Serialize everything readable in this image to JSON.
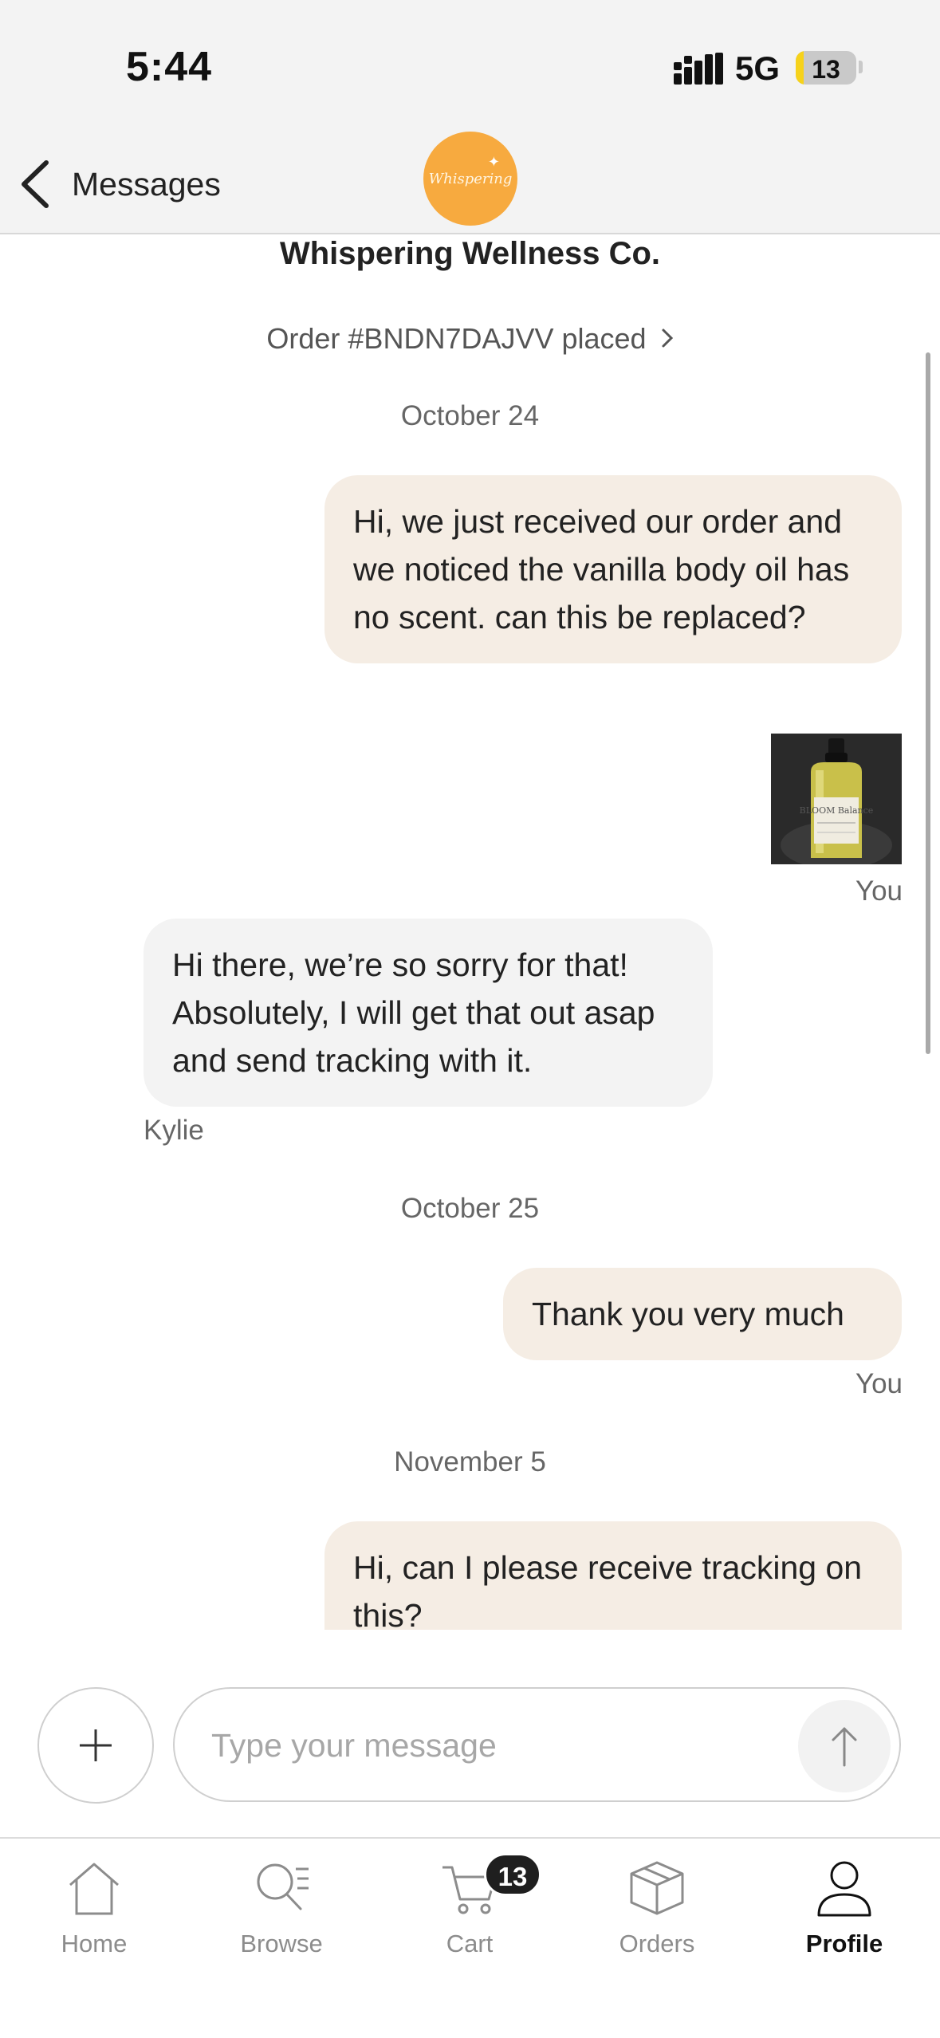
{
  "status_bar": {
    "time": "5:44",
    "network": "5G",
    "battery": "13",
    "battery_level": 0.13
  },
  "header": {
    "back_label": "Messages",
    "shop_logo_text": "Whispering"
  },
  "conversation": {
    "shop_name": "Whispering Wellness Co.",
    "order_link": "Order #BNDN7DAJVV placed",
    "dates": [
      "October 24",
      "October 25",
      "November 5"
    ],
    "messages": [
      {
        "from": "me",
        "text": "Hi, we just received our order and we noticed the vanilla body oil has no scent. can this be replaced?"
      },
      {
        "from": "me",
        "attachment": "photo-of-body-oil-bottle",
        "attachment_label": "BLOOM Balance",
        "sender_label": "You"
      },
      {
        "from": "shop",
        "text": "Hi there, we’re so sorry for that! Absolutely, I will get that out asap and send tracking with it.",
        "sender_label": "Kylie"
      },
      {
        "from": "me",
        "text": "Thank you very much",
        "sender_label": "You"
      },
      {
        "from": "me",
        "text": "Hi, can I please receive tracking on this?"
      }
    ]
  },
  "composer": {
    "placeholder": "Type your message",
    "value": ""
  },
  "tab_bar": {
    "items": [
      {
        "label": "Home",
        "icon": "home-icon",
        "active": false
      },
      {
        "label": "Browse",
        "icon": "browse-icon",
        "active": false
      },
      {
        "label": "Cart",
        "icon": "cart-icon",
        "active": false,
        "badge": "13"
      },
      {
        "label": "Orders",
        "icon": "box-icon",
        "active": false
      },
      {
        "label": "Profile",
        "icon": "person-icon",
        "active": true
      }
    ]
  },
  "colors": {
    "my_bubble": "#f5ede4",
    "their_bubble": "#f3f3f3",
    "logo": "#f7aa3f",
    "battery_fill": "#f6d21b"
  }
}
